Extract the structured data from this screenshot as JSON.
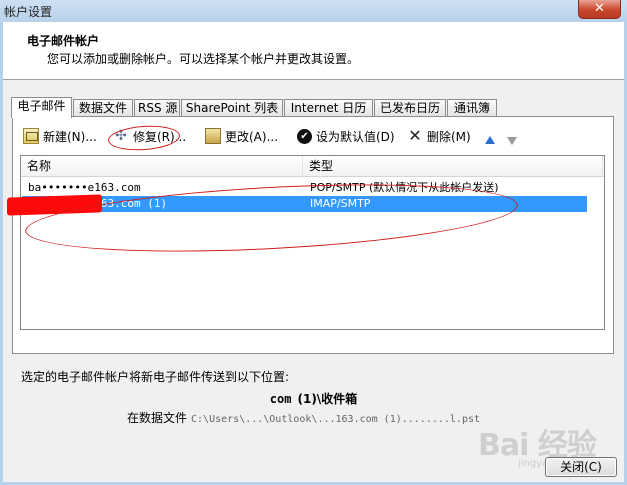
{
  "window": {
    "title": "帐户设置",
    "close_glyph": "✕"
  },
  "header": {
    "title": "电子邮件帐户",
    "subtitle": "您可以添加或删除帐户。可以选择某个帐户并更改其设置。"
  },
  "tabs": [
    {
      "label": "电子邮件",
      "active": true
    },
    {
      "label": "数据文件"
    },
    {
      "label": "RSS 源"
    },
    {
      "label": "SharePoint 列表"
    },
    {
      "label": "Internet 日历"
    },
    {
      "label": "已发布日历"
    },
    {
      "label": "通讯簿"
    }
  ],
  "toolbar": {
    "new_label": "新建(N)...",
    "repair_label": "修复(R)...",
    "change_label": "更改(A)...",
    "set_default_label": "设为默认值(D)",
    "delete_label": "删除(M)"
  },
  "accounts_table": {
    "columns": [
      "名称",
      "类型"
    ],
    "rows": [
      {
        "name": "ba•••••••e163.com",
        "type": "POP/SMTP (默认情况下从此帐户发送)"
      },
      {
        "name": "••••••••••163.com (1)",
        "type": "IMAP/SMTP",
        "selected": true
      }
    ]
  },
  "delivery": {
    "caption": "选定的电子邮件帐户将新电子邮件传送到以下位置:",
    "folder_prefix": "com",
    "folder": "(1)\\收件箱",
    "datafile_label": "在数据文件",
    "datafile_path": "C:\\Users\\...\\Outlook\\...163.com (1)........l.pst"
  },
  "buttons": {
    "close_label": "关闭(C)"
  },
  "watermark": {
    "text": "Bai 经验",
    "sub": "jingyan.baidu.com"
  },
  "colors": {
    "selection": "#3399ff",
    "annotation": "#d11a1a",
    "redaction": "#ff0a0a"
  }
}
